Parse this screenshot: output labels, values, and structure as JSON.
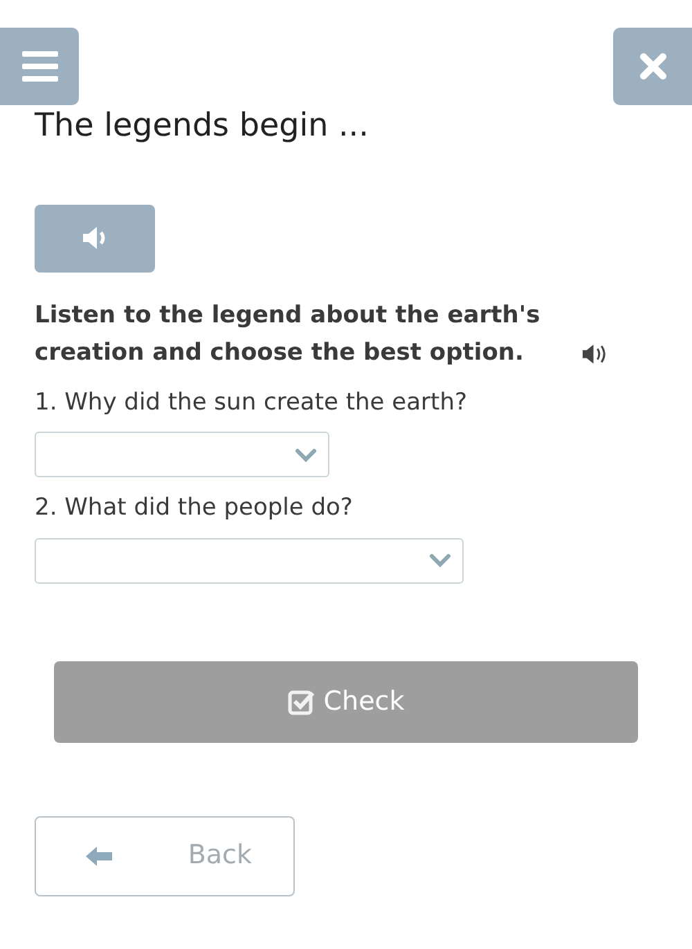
{
  "header": {
    "title": "The legends begin ..."
  },
  "instruction": "Listen to the legend about the earth's creation and choose the best option.",
  "questions": [
    {
      "text": "1. Why did the sun create the earth?"
    },
    {
      "text": "2. What did the people do?"
    }
  ],
  "check_button": {
    "label": "Check",
    "disabled": true
  },
  "back_button": {
    "label": "Back"
  }
}
